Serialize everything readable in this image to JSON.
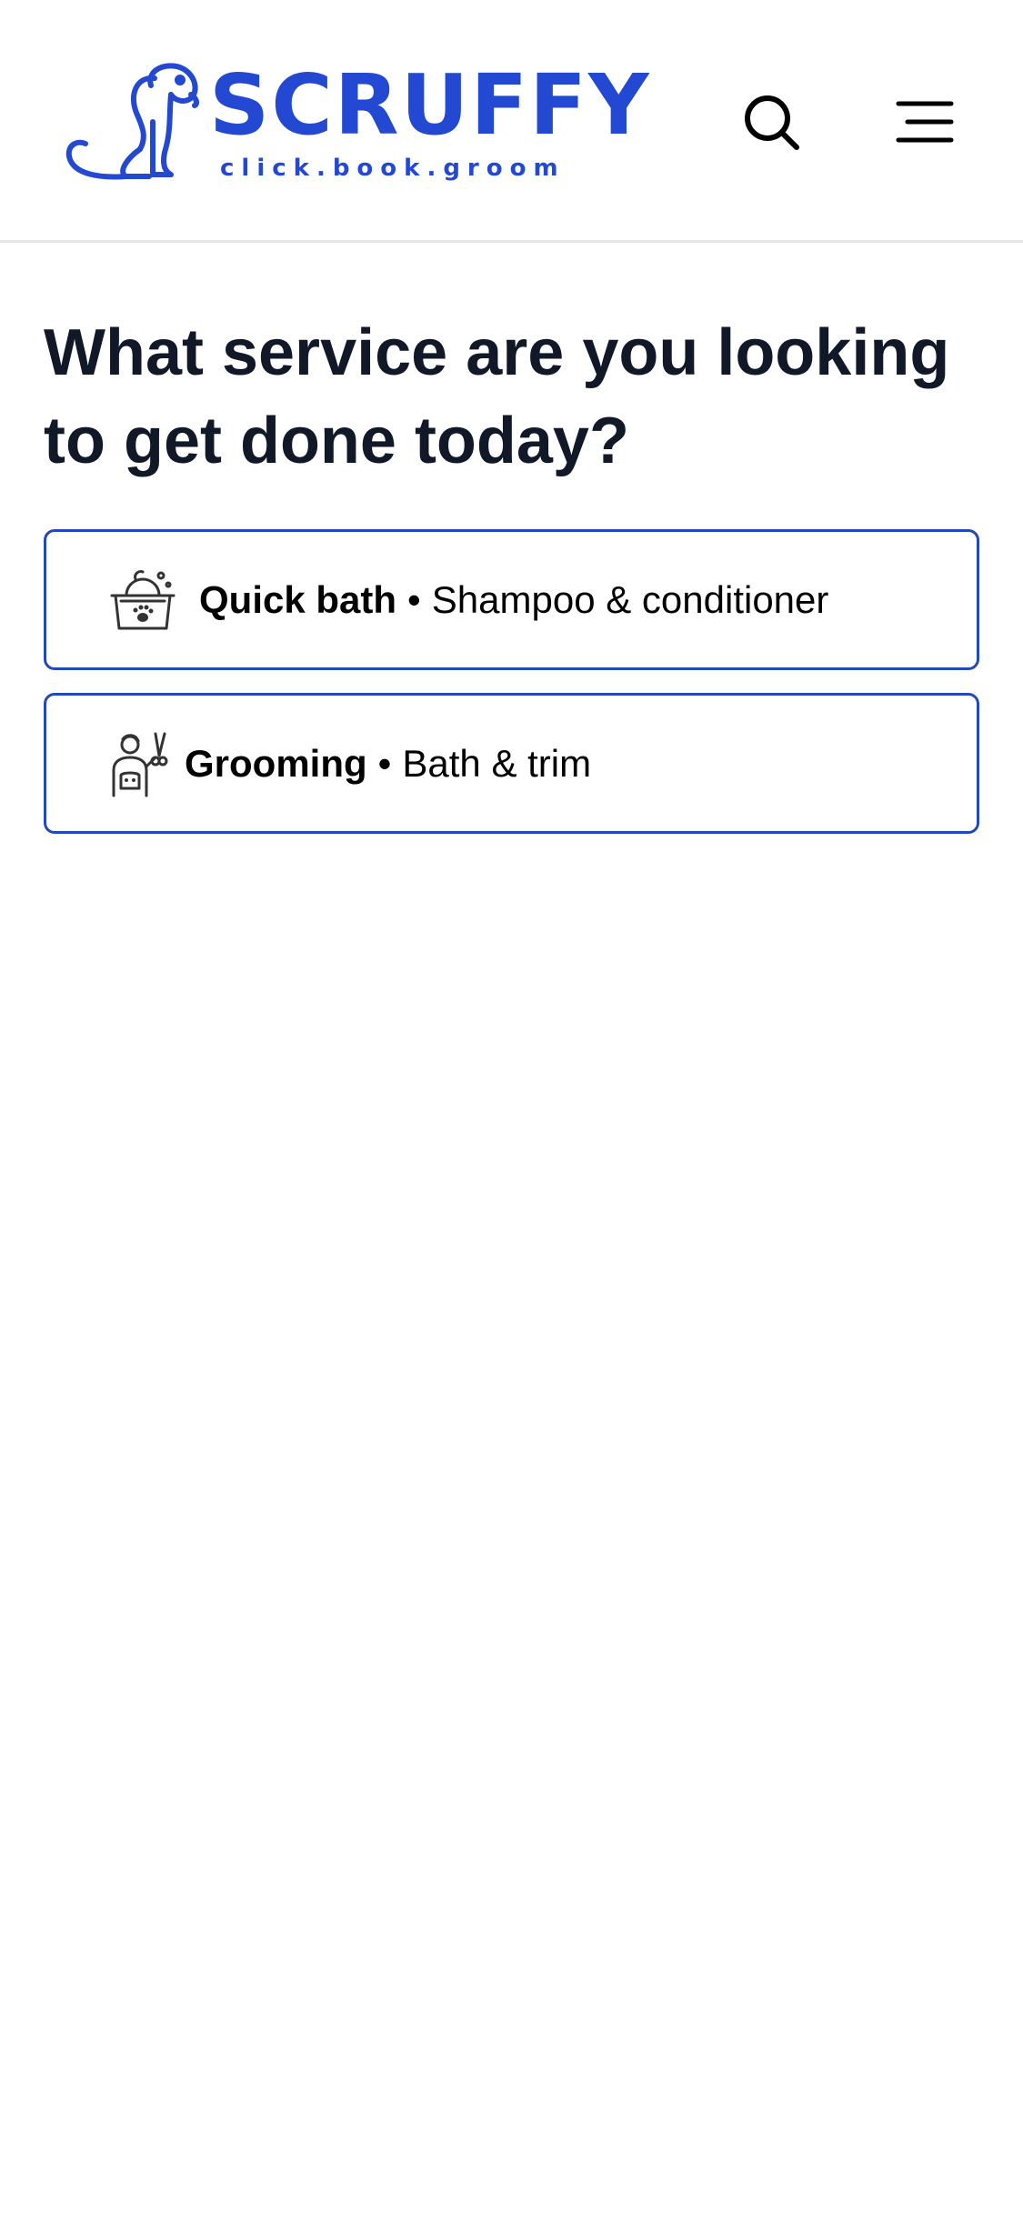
{
  "brand": {
    "name": "SCRUFFY",
    "tagline": "click.book.groom",
    "color": "#2348d2"
  },
  "header": {
    "search_icon": "search-icon",
    "menu_icon": "hamburger-menu-icon"
  },
  "main": {
    "question": "What service are you looking to get done today?",
    "options": [
      {
        "icon": "bath-tub-icon",
        "title": "Quick bath",
        "separator": "•",
        "description": "Shampoo & conditioner"
      },
      {
        "icon": "groomer-icon",
        "title": "Grooming",
        "separator": "•",
        "description": "Bath & trim"
      }
    ]
  },
  "colors": {
    "accent": "#2348d2",
    "option_border": "#2348b8",
    "heading": "#111827"
  }
}
